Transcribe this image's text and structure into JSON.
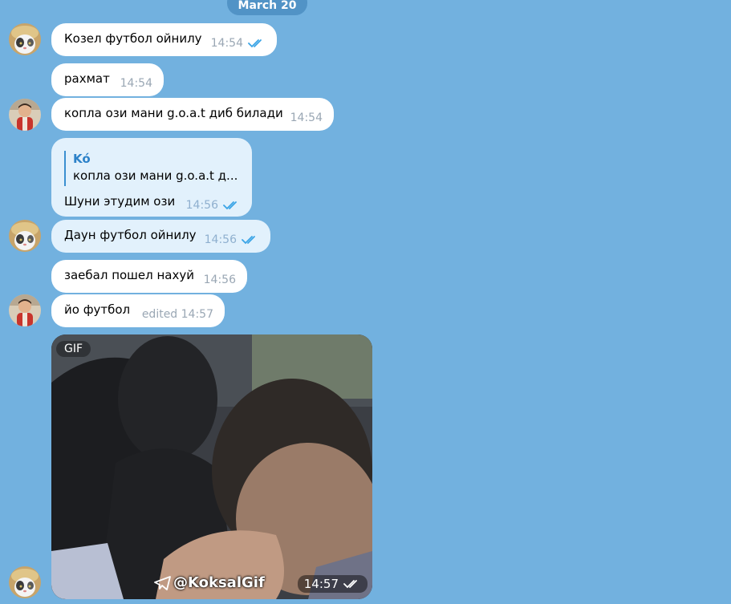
{
  "date_separator": "March 20",
  "colors": {
    "background": "#72b1df",
    "incoming_bubble": "#ffffff",
    "outgoing_bubble": "#e2f1fc",
    "check_color": "#3aa4e6",
    "reply_accent": "#2c82c9"
  },
  "messages": [
    {
      "text": "Козел футбол ойнилу",
      "time": "14:54",
      "status": "read-checks-icon"
    },
    {
      "text": "рахмат",
      "time": "14:54"
    },
    {
      "text": "копла ози мани g.o.a.t диб билади",
      "time": "14:54"
    },
    {
      "reply_name": "Kó",
      "reply_text": "копла ози мани g.o.a.t д...",
      "text": "Шуни этудим ози",
      "time": "14:56",
      "status": "read-checks-icon"
    },
    {
      "text": "Даун футбол ойнилу",
      "time": "14:56",
      "status": "read-checks-icon"
    },
    {
      "text": "заебал пошел нахуй",
      "time": "14:56"
    },
    {
      "text": "йо футбол",
      "time": "edited 14:57"
    }
  ],
  "gif": {
    "badge": "GIF",
    "watermark": "@KoksalGif",
    "time": "14:57"
  }
}
